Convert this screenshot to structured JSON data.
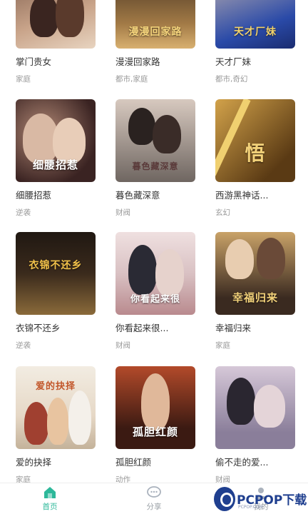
{
  "dramas": [
    {
      "title": "掌门贵女",
      "tag": "家庭",
      "poster_text": "",
      "colors": [
        "#7a5a4a",
        "#c9a48a"
      ]
    },
    {
      "title": "漫漫回家路",
      "tag": "都市,家庭",
      "poster_text": "漫漫回家路",
      "colors": [
        "#3a2a1e",
        "#a27a46"
      ]
    },
    {
      "title": "天才厂妹",
      "tag": "都市,奇幻",
      "poster_text": "天才厂妹",
      "colors": [
        "#2a4aa8",
        "#e6b84a"
      ]
    },
    {
      "title": "细腰招惹",
      "tag": "逆袭",
      "poster_text": "细腰招惹",
      "colors": [
        "#3a2322",
        "#b08774"
      ]
    },
    {
      "title": "暮色藏深意",
      "tag": "财阀",
      "poster_text": "暮色藏深意",
      "colors": [
        "#6f6661",
        "#d7c9bf"
      ]
    },
    {
      "title": "西游黑神话...",
      "tag": "玄幻",
      "poster_text": "悟",
      "colors": [
        "#5a3a14",
        "#d2a24a"
      ]
    },
    {
      "title": "衣锦不还乡",
      "tag": "逆袭",
      "poster_text": "衣锦不还乡",
      "colors": [
        "#201812",
        "#8a6a3a"
      ]
    },
    {
      "title": "你看起来很...",
      "tag": "财阀",
      "poster_text": "你看起来很",
      "colors": [
        "#d9c1c3",
        "#a8444a"
      ]
    },
    {
      "title": "幸福归来",
      "tag": "家庭",
      "poster_text": "幸福归来",
      "colors": [
        "#3a2a20",
        "#c9a268"
      ]
    },
    {
      "title": "爱的抉择",
      "tag": "家庭",
      "poster_text": "爱的抉择",
      "colors": [
        "#e6d8c6",
        "#b0602a"
      ]
    },
    {
      "title": "孤胆红颜",
      "tag": "动作",
      "poster_text": "孤胆红颜",
      "colors": [
        "#3b1a12",
        "#b34a2a"
      ]
    },
    {
      "title": "偷不走的爱...",
      "tag": "财阀",
      "poster_text": "",
      "colors": [
        "#8a7e9a",
        "#d6c8d8"
      ]
    }
  ],
  "nav": {
    "home_label": "首页",
    "share_label": "分享",
    "mine_label": "我的"
  },
  "watermark": {
    "brand": "PCPOP下载",
    "sub": "PCPOP.COM"
  }
}
